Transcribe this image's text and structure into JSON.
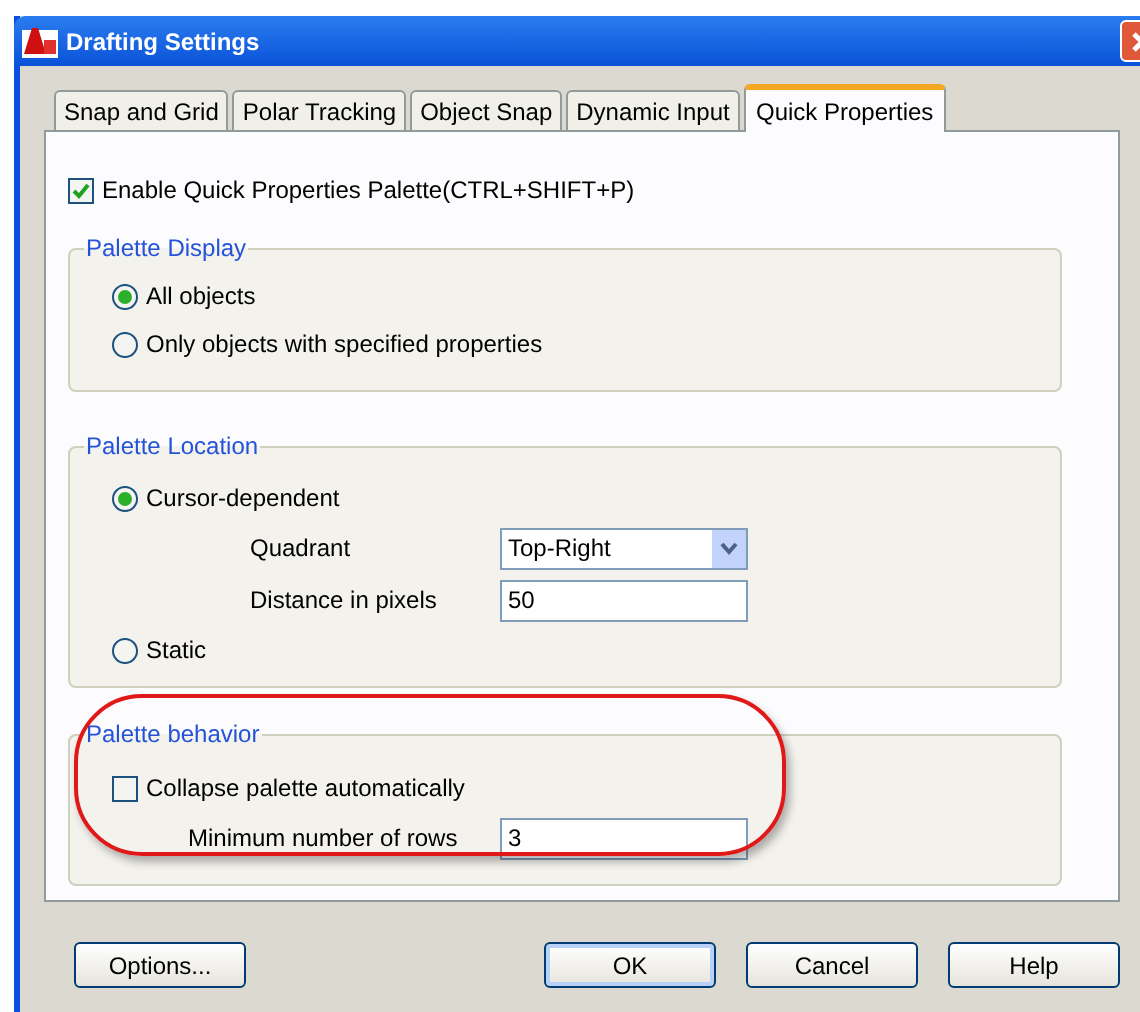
{
  "window": {
    "title": "Drafting Settings"
  },
  "tabs": [
    {
      "label": "Snap and Grid",
      "selected": false
    },
    {
      "label": "Polar Tracking",
      "selected": false
    },
    {
      "label": "Object Snap",
      "selected": false
    },
    {
      "label": "Dynamic Input",
      "selected": false
    },
    {
      "label": "Quick Properties",
      "selected": true
    }
  ],
  "enable_palette": {
    "label": "Enable Quick Properties Palette(CTRL+SHIFT+P)",
    "checked": true
  },
  "groups": [
    {
      "title": "Palette Display",
      "items": [
        {
          "kind": "radio",
          "label": "All objects",
          "selected": true
        },
        {
          "kind": "radio",
          "label": "Only objects with specified properties",
          "selected": false
        }
      ]
    },
    {
      "title": "Palette Location",
      "items": [
        {
          "kind": "radio",
          "label": "Cursor-dependent",
          "selected": true
        },
        {
          "kind": "dropdown",
          "label": "Quadrant",
          "value": "Top-Right"
        },
        {
          "kind": "field",
          "label": "Distance in pixels",
          "value": "50"
        },
        {
          "kind": "radio",
          "label": "Static",
          "selected": false
        }
      ]
    },
    {
      "title": "Palette behavior",
      "items": [
        {
          "kind": "checkbox",
          "label": "Collapse palette automatically",
          "checked": false
        },
        {
          "kind": "field",
          "label": "Minimum number of rows",
          "value": "3"
        }
      ]
    }
  ],
  "buttons": [
    {
      "label": "Options..."
    },
    {
      "label": "OK"
    },
    {
      "label": "Cancel"
    },
    {
      "label": "Help"
    }
  ]
}
